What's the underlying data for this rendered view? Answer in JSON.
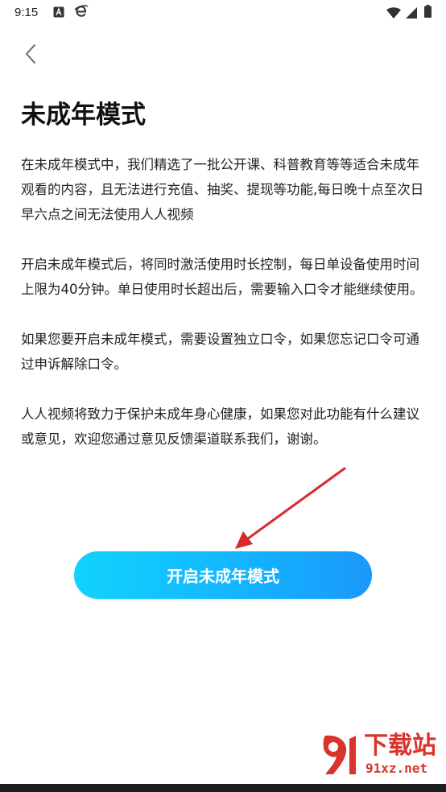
{
  "status_bar": {
    "time": "9:15",
    "left_icons": [
      "a-notification-icon",
      "browser-e-icon"
    ],
    "right_icons": [
      "wifi-icon",
      "signal-icon",
      "battery-icon"
    ]
  },
  "header": {
    "back_icon": "chevron-left-icon"
  },
  "page": {
    "title": "未成年模式",
    "paragraphs": [
      "在未成年模式中，我们精选了一批公开课、科普教育等等适合未成年观看的内容，且无法进行充值、抽奖、提现等功能,每日晚十点至次日早六点之间无法使用人人视频",
      " 开启未成年模式后，将同时激活使用时长控制，每日单设备使用时间上限为40分钟。单日使用时长超出后，需要输入口令才能继续使用。",
      " 如果您要开启未成年模式，需要设置独立口令，如果您忘记口令可通过申诉解除口令。",
      " 人人视频将致力于保护未成年身心健康，如果您对此功能有什么建议或意见，欢迎您通过意见反馈渠道联系我们，谢谢。"
    ],
    "enable_button_label": "开启未成年模式"
  },
  "watermark": {
    "text": "下载站",
    "url_text": "91xz.net"
  },
  "colors": {
    "button_gradient_start": "#12d3fd",
    "button_gradient_end": "#1a98fb",
    "annotation_arrow": "#d62b2b",
    "watermark_red": "#d9342b"
  }
}
